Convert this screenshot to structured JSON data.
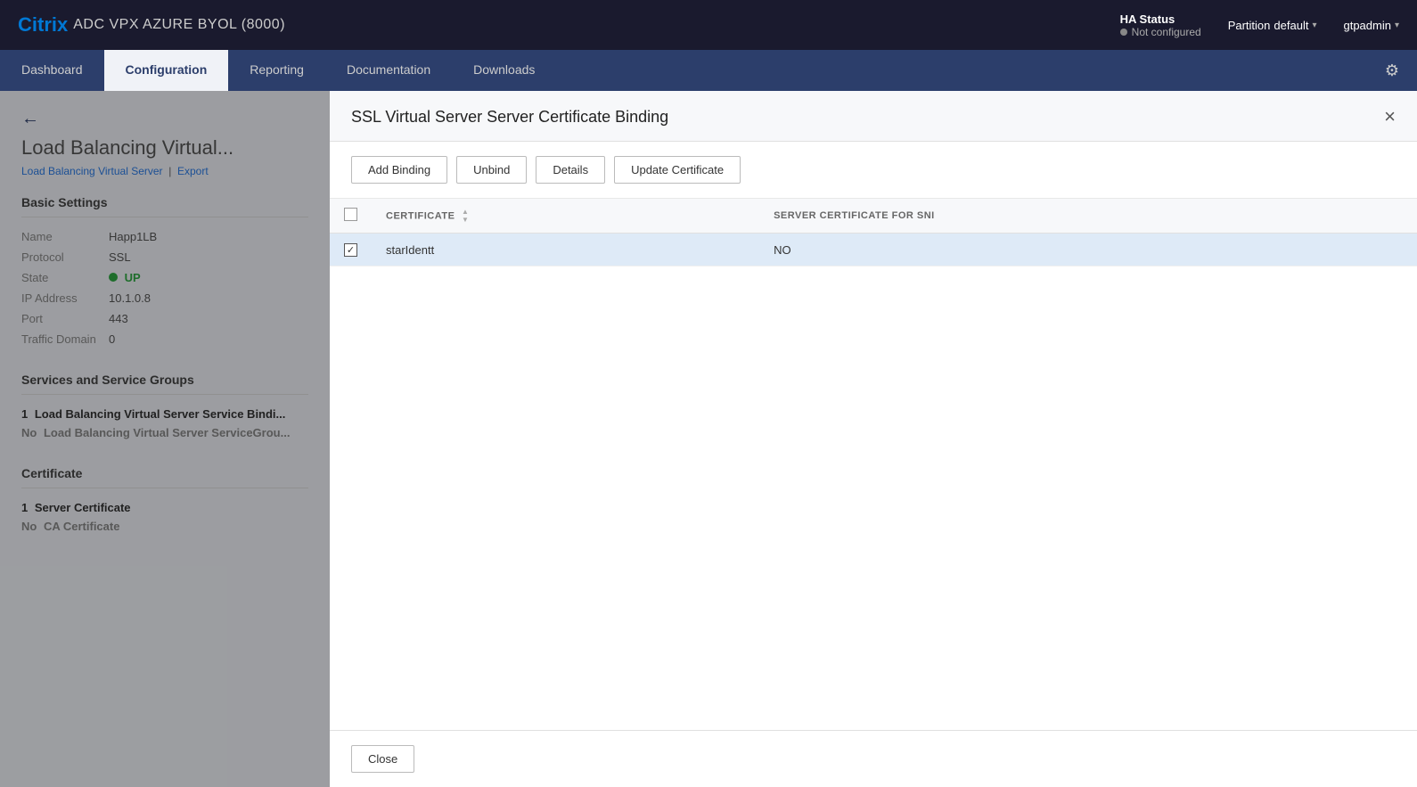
{
  "header": {
    "brand_citrix": "Citrix",
    "brand_product": "ADC VPX AZURE BYOL (8000)",
    "ha_status_label": "HA Status",
    "ha_status_value": "Not configured",
    "partition_label": "Partition",
    "partition_value": "default",
    "user": "gtpadmin"
  },
  "nav": {
    "tabs": [
      {
        "id": "dashboard",
        "label": "Dashboard",
        "active": false
      },
      {
        "id": "configuration",
        "label": "Configuration",
        "active": true
      },
      {
        "id": "reporting",
        "label": "Reporting",
        "active": false
      },
      {
        "id": "documentation",
        "label": "Documentation",
        "active": false
      },
      {
        "id": "downloads",
        "label": "Downloads",
        "active": false
      }
    ]
  },
  "background": {
    "page_title": "Load Balancing Virtual...",
    "breadcrumb_link": "Load Balancing Virtual Server",
    "breadcrumb_sep": "|",
    "breadcrumb_action": "Export",
    "sections": {
      "basic_settings": {
        "title": "Basic Settings",
        "fields": [
          {
            "label": "Name",
            "value": "Happ1LB"
          },
          {
            "label": "Protocol",
            "value": "SSL"
          },
          {
            "label": "State",
            "value": "UP",
            "is_status": true
          },
          {
            "label": "IP Address",
            "value": "10.1.0.8"
          },
          {
            "label": "Port",
            "value": "443"
          },
          {
            "label": "Traffic Domain",
            "value": "0"
          }
        ]
      },
      "services": {
        "title": "Services and Service Groups",
        "items": [
          {
            "count": "1",
            "label": "Load Balancing Virtual Server Service Bindi..."
          },
          {
            "count": "No",
            "label": "Load Balancing Virtual Server ServiceGrou..."
          }
        ]
      },
      "certificate": {
        "title": "Certificate",
        "items": [
          {
            "count": "1",
            "label": "Server Certificate"
          },
          {
            "count": "No",
            "label": "CA Certificate"
          }
        ]
      }
    }
  },
  "modal": {
    "title": "SSL Virtual Server Server Certificate Binding",
    "close_button": "×",
    "toolbar_buttons": [
      {
        "id": "add-binding",
        "label": "Add Binding"
      },
      {
        "id": "unbind",
        "label": "Unbind"
      },
      {
        "id": "details",
        "label": "Details"
      },
      {
        "id": "update-certificate",
        "label": "Update Certificate"
      }
    ],
    "table": {
      "columns": [
        {
          "id": "checkbox",
          "label": ""
        },
        {
          "id": "certificate",
          "label": "CERTIFICATE",
          "sortable": true
        },
        {
          "id": "sni",
          "label": "SERVER CERTIFICATE FOR SNI"
        }
      ],
      "rows": [
        {
          "checked": true,
          "certificate": "starIdentt",
          "sni": "NO",
          "selected": true
        }
      ]
    },
    "close_label": "Close"
  }
}
